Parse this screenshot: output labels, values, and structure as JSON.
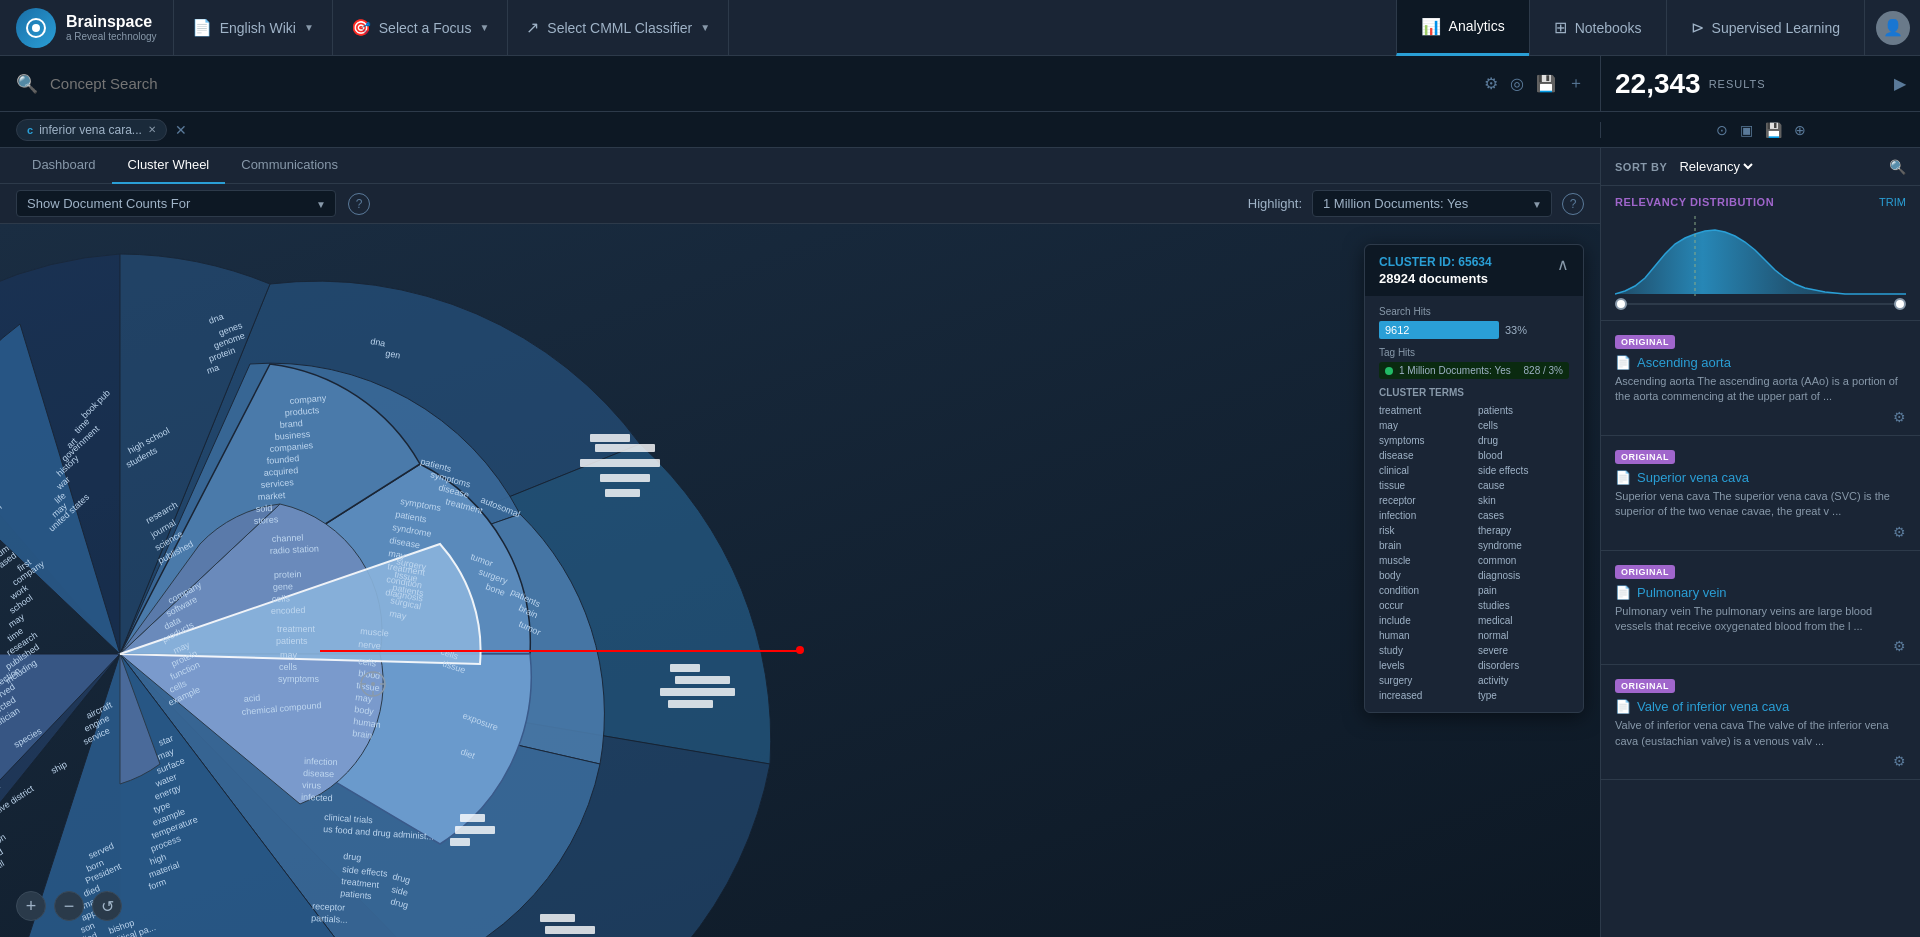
{
  "app": {
    "logo_main": "Brainspace",
    "logo_sub": "a Reveal technology"
  },
  "nav": {
    "dataset": "English Wiki",
    "focus": "Select a Focus",
    "cmml": "Select CMML Classifier",
    "analytics": "Analytics",
    "notebooks": "Notebooks",
    "supervised": "Supervised Learning"
  },
  "search": {
    "placeholder": "Concept Search",
    "tag": "inferior vena cara..."
  },
  "results": {
    "count": "22,343",
    "label": "RESULTS"
  },
  "tabs": {
    "dashboard": "Dashboard",
    "cluster_wheel": "Cluster Wheel",
    "communications": "Communications"
  },
  "filter": {
    "show_doc_counts": "Show Document Counts For",
    "highlight_label": "Highlight:",
    "highlight_value": "1 Million Documents: Yes"
  },
  "sort": {
    "label": "SORT BY",
    "value": "Relevancy"
  },
  "relevancy": {
    "title": "RELEVANCY DISTRIBUTION",
    "trim": "TRIM"
  },
  "cluster": {
    "id": "CLUSTER ID: 65634",
    "docs": "28924 documents",
    "search_hits_label": "Search Hits",
    "search_hits_count": "9612",
    "search_hits_pct": "33%",
    "tag_hits_label": "Tag Hits",
    "tag_name": "1 Million Documents: Yes",
    "tag_count": "828 / 3%",
    "terms_label": "CLUSTER TERMS",
    "terms_left": [
      "treatment",
      "may",
      "symptoms",
      "disease",
      "clinical",
      "tissue",
      "receptor",
      "infection",
      "risk",
      "brain",
      "muscle",
      "body",
      "condition",
      "occur",
      "include",
      "human",
      "study",
      "levels",
      "surgery",
      "increased"
    ],
    "terms_right": [
      "patients",
      "cells",
      "drug",
      "blood",
      "side effects",
      "cause",
      "skin",
      "cases",
      "therapy",
      "syndrome",
      "common",
      "diagnosis",
      "pain",
      "studies",
      "medical",
      "normal",
      "severe",
      "disorders",
      "activity",
      "type"
    ]
  },
  "result_cards": [
    {
      "badge": "ORIGINAL",
      "title": "Ascending aorta",
      "desc": "Ascending aorta The ascending aorta (AAo) is a portion of the aorta commencing at the upper part of ..."
    },
    {
      "badge": "ORIGINAL",
      "title": "Superior vena cava",
      "desc": "Superior vena cava The superior vena cava (SVC) is the superior of the two venae cavae, the great v ..."
    },
    {
      "badge": "ORIGINAL",
      "title": "Pulmonary vein",
      "desc": "Pulmonary vein The pulmonary veins are large blood vessels that receive oxygenated blood from the l ..."
    },
    {
      "badge": "ORIGINAL",
      "title": "Valve of inferior vena cava",
      "desc": "Valve of inferior vena cava The valve of the inferior vena cava (eustachian valve) is a venous valv ..."
    }
  ],
  "wheel_controls": {
    "zoom_in": "+",
    "zoom_out": "−",
    "reset": "↺"
  }
}
